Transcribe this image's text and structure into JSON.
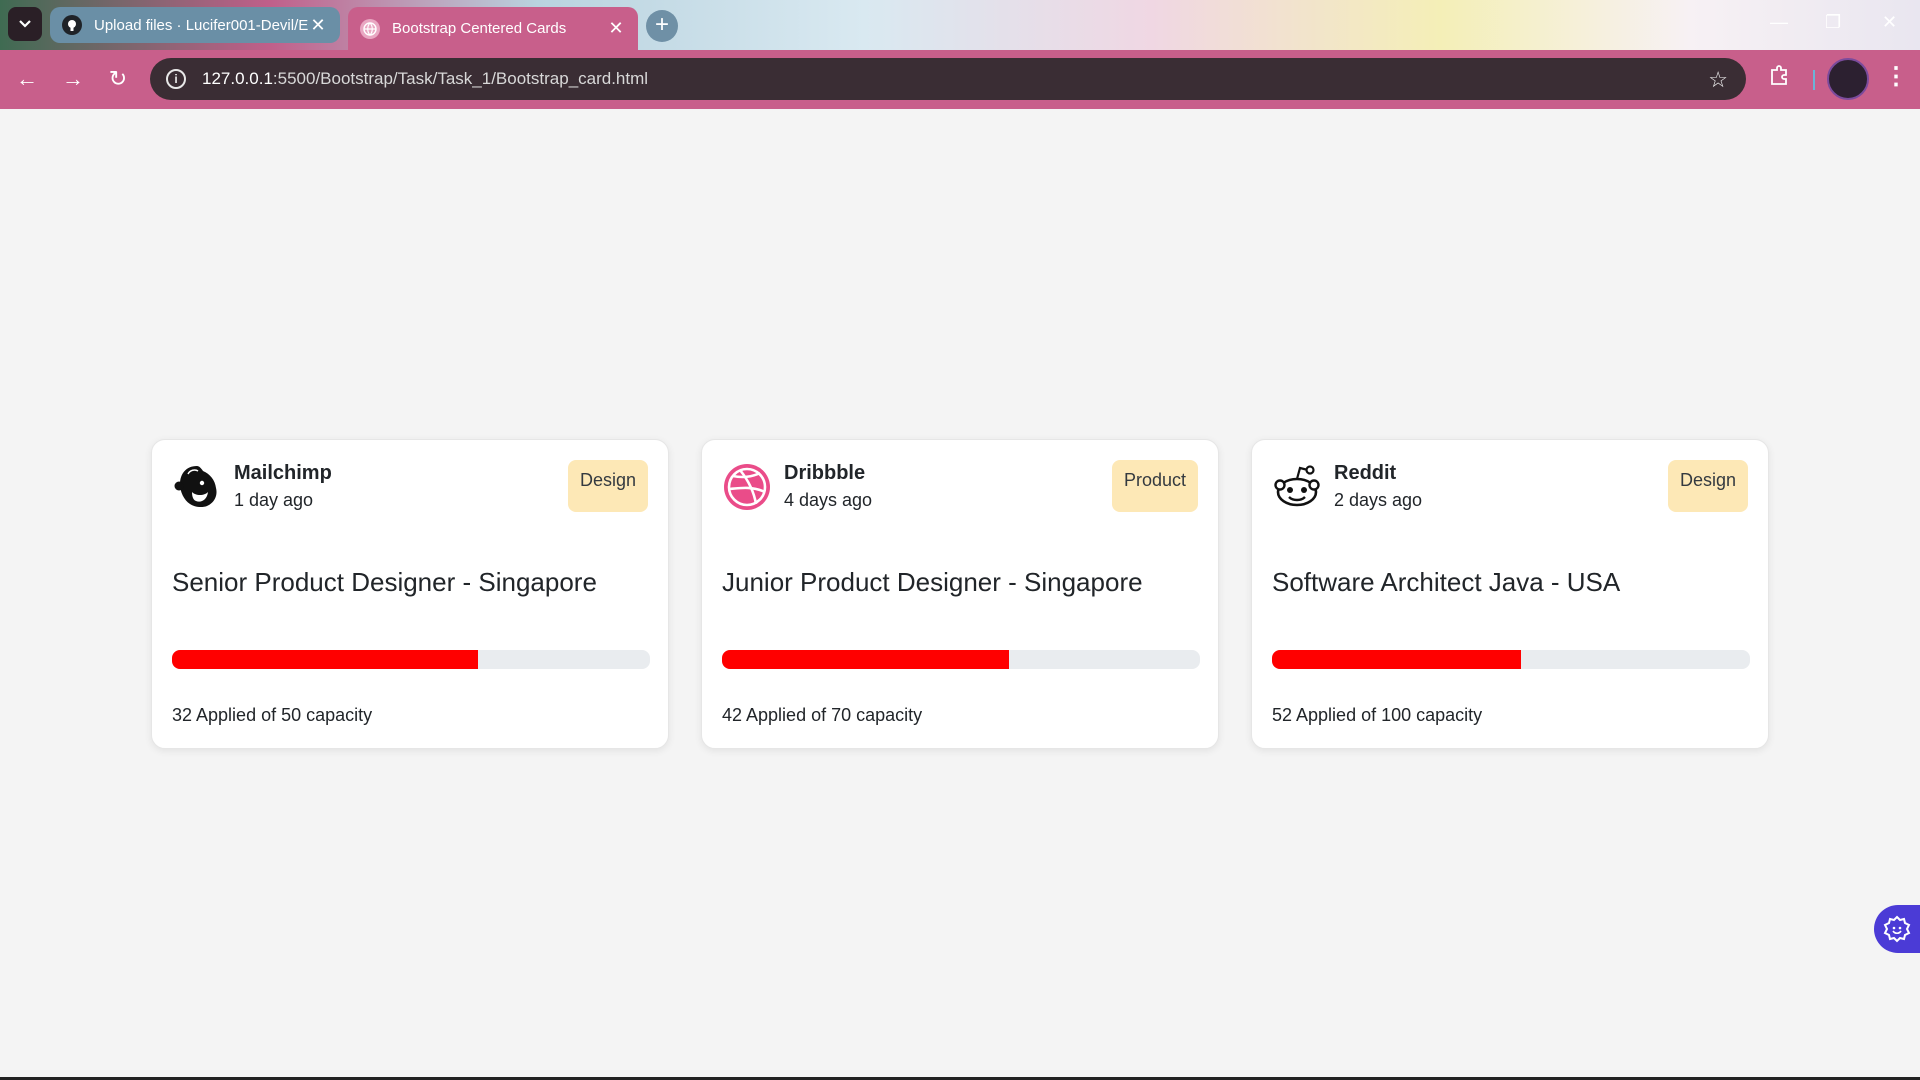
{
  "browser": {
    "tabs": [
      {
        "title": "Upload files · Lucifer001-Devil/E",
        "close": "✕"
      },
      {
        "title": "Bootstrap Centered Cards",
        "close": "✕"
      }
    ],
    "new_tab": "+",
    "url_host": "127.0.0.1",
    "url_path": ":5500/Bootstrap/Task/Task_1/Bootstrap_card.html"
  },
  "cards": [
    {
      "company": "Mailchimp",
      "posted": "1 day ago",
      "badge": "Design",
      "title": "Senior Product Designer - Singapore",
      "applied": 32,
      "capacity_max": 50,
      "capacity_text": "32 Applied of 50 capacity",
      "logo_icon": "mailchimp-icon"
    },
    {
      "company": "Dribbble",
      "posted": "4 days ago",
      "badge": "Product",
      "title": "Junior Product Designer - Singapore",
      "applied": 42,
      "capacity_max": 70,
      "capacity_text": "42 Applied of 70 capacity",
      "logo_icon": "dribbble-icon"
    },
    {
      "company": "Reddit",
      "posted": "2 days ago",
      "badge": "Design",
      "title": "Software Architect Java - USA",
      "applied": 52,
      "capacity_max": 100,
      "capacity_text": "52 Applied of 100 capacity",
      "logo_icon": "reddit-icon"
    }
  ],
  "colors": {
    "progress_fill": "#ff0000",
    "badge_bg": "#fde8b6",
    "dribbble_pink": "#ea4c89",
    "browser_accent": "#c85f8b"
  }
}
